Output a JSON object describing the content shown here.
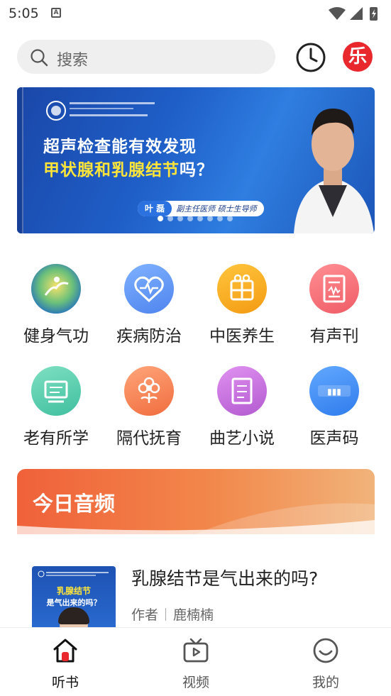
{
  "status_bar": {
    "time": "5:05",
    "notification_glyph": "A"
  },
  "search": {
    "placeholder": "搜索"
  },
  "header": {
    "logo_glyph": "乐"
  },
  "banner": {
    "line1": "超声检查能有效发现",
    "line2_highlight": "甲状腺和乳腺结节",
    "line2_suffix": "吗？",
    "doctor_name": "叶 磊",
    "doctor_title": "副主任医师  硕士生导师",
    "slide_count": 8,
    "active_slide": 0
  },
  "categories": [
    {
      "label": "健身气功",
      "icon": "qigong-icon",
      "color": "#3a9a5a"
    },
    {
      "label": "疾病防治",
      "icon": "heart-pulse-icon",
      "color": "#5b8ff0"
    },
    {
      "label": "中医养生",
      "icon": "herb-box-icon",
      "color": "#f5a623"
    },
    {
      "label": "有声刊",
      "icon": "magazine-icon",
      "color": "#f06a72"
    },
    {
      "label": "老有所学",
      "icon": "glasses-icon",
      "color": "#4cc9a8"
    },
    {
      "label": "隔代抚育",
      "icon": "flower-icon",
      "color": "#f38a5a"
    },
    {
      "label": "曲艺小说",
      "icon": "book-icon",
      "color": "#c06ad8"
    },
    {
      "label": "医声码",
      "icon": "med-code-icon",
      "color": "#3d8ff0"
    }
  ],
  "today": {
    "title": "今日音频"
  },
  "article": {
    "title": "乳腺结节是气出来的吗?",
    "author_label": "作者",
    "author": "鹿楠楠",
    "thumb_line1": "乳腺结节",
    "thumb_line2": "是气出来的吗？"
  },
  "bottom_nav": [
    {
      "label": "听书",
      "icon": "home-icon",
      "active": true
    },
    {
      "label": "视频",
      "icon": "tv-icon",
      "active": false
    },
    {
      "label": "我的",
      "icon": "smile-icon",
      "active": false
    }
  ]
}
